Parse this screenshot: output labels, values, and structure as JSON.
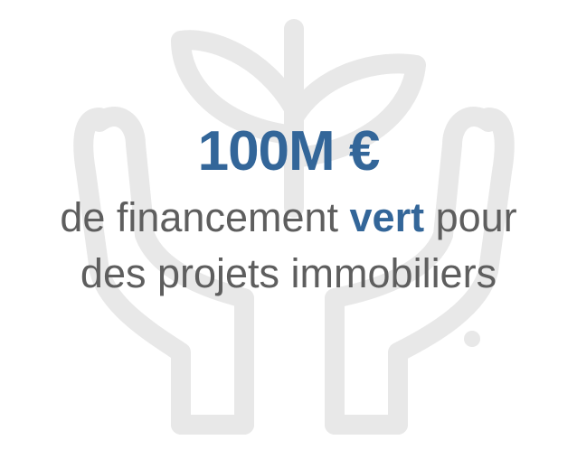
{
  "headline": "100M €",
  "body": {
    "line1_prefix": "de financement ",
    "line1_accent": "vert",
    "line1_suffix": " pour",
    "line2": "des projets immobiliers"
  },
  "colors": {
    "accent": "#336699",
    "text": "#5e5e5e",
    "watermark": "#e8e8e8"
  },
  "icon": "hands-holding-plant-icon"
}
